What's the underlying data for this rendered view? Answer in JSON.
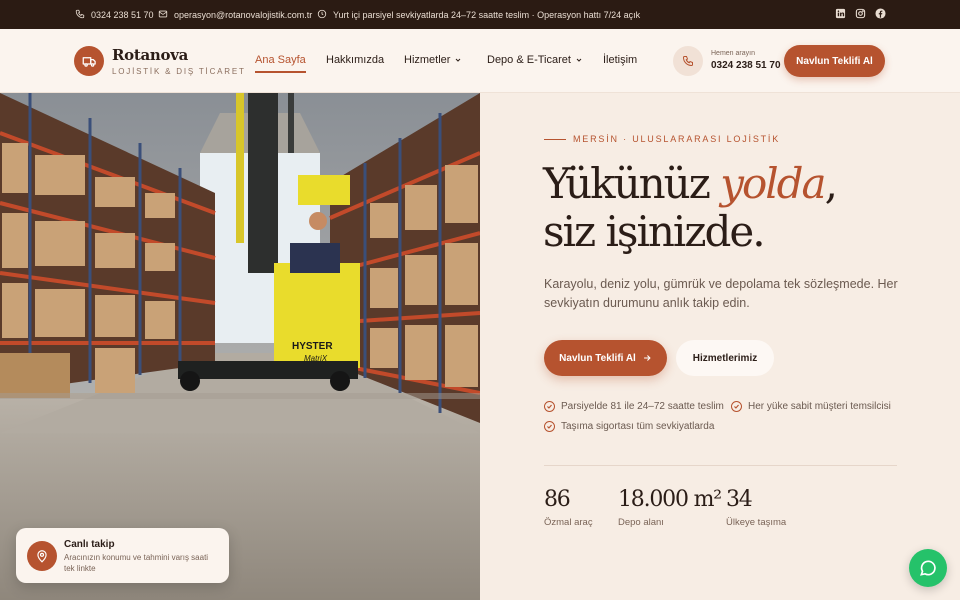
{
  "topbar": {
    "phone": "0324 238 51 70",
    "email": "operasyon@rotanovalojistik.com.tr",
    "notice": "Yurt içi parsiyel sevkiyatlarda 24–72 saatte teslim · Operasyon hattı 7/24 açık",
    "social": [
      "linkedin-icon",
      "instagram-icon",
      "facebook-icon"
    ]
  },
  "header": {
    "brand": "Rotanova",
    "tagline": "LOJİSTİK & DIŞ TİCARET",
    "nav": [
      {
        "label": "Ana Sayfa",
        "active": true
      },
      {
        "label": "Hakkımızda"
      },
      {
        "label": "Hizmetler",
        "dropdown": true
      },
      {
        "label": "Depo & E-Ticaret",
        "dropdown": true
      },
      {
        "label": "İletişim"
      }
    ],
    "call_label": "Hemen arayın",
    "call_number": "0324 238 51 70",
    "cta": "Navlun Teklifi Al"
  },
  "hero": {
    "eyebrow": "MERSİN · ULUSLARARASI LOJİSTİK",
    "headline_part1": "Yükünüz",
    "headline_accent": "yolda",
    "headline_part2": ",",
    "headline_line2": "siz işinizde.",
    "lead": "Karayolu, deniz yolu, gümrük ve depolama tek sözleşmede. Her sevkiyatın durumunu anlık takip edin.",
    "primary_button": "Navlun Teklifi Al",
    "secondary_button": "Hizmetlerimiz",
    "features": [
      "Parsiyelde 81 ile 24–72 saatte teslim",
      "Her yüke sabit müşteri temsilcisi",
      "Taşıma sigortası tüm sevkiyatlarda"
    ],
    "stats": [
      {
        "value": "86",
        "label": "Özmal araç"
      },
      {
        "value": "18.000 m²",
        "label": "Depo alanı"
      },
      {
        "value": "34",
        "label": "Ülkeye taşıma"
      }
    ]
  },
  "tracking_card": {
    "title": "Canlı takip",
    "description": "Aracınızın konumu ve tahmini varış saati tek linkte"
  },
  "colors": {
    "accent": "#b6532f",
    "topbar": "#2b1b13",
    "background": "#f7ede4",
    "chat": "#25c26a"
  }
}
